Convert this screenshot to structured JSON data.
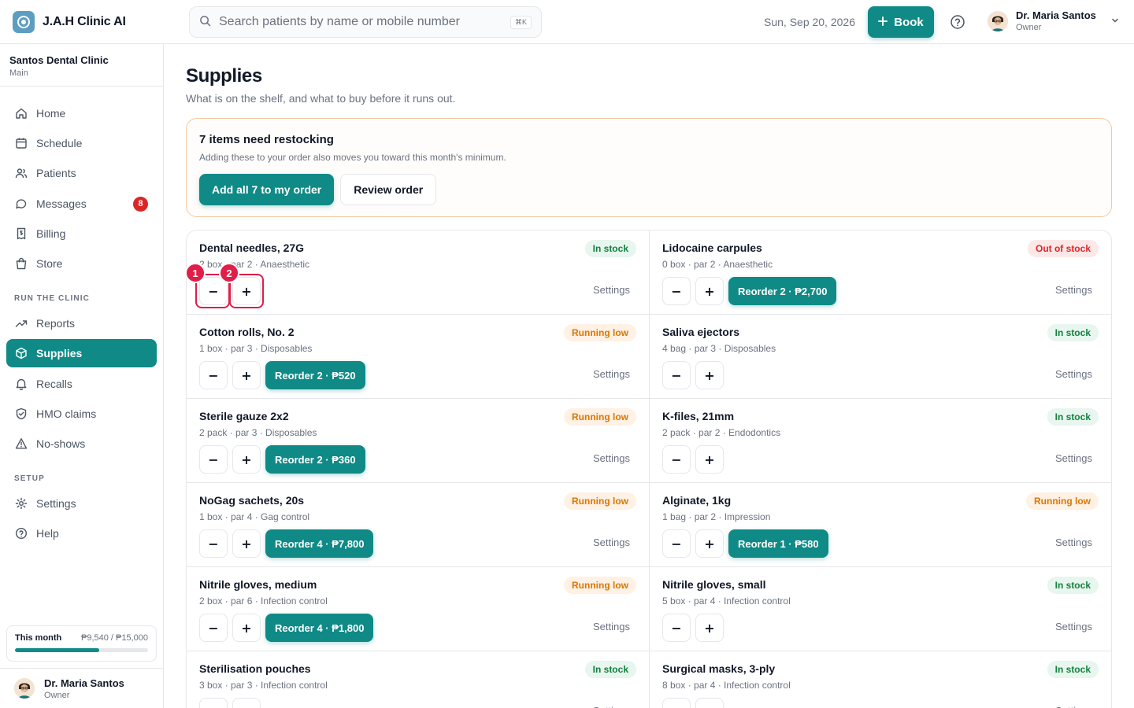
{
  "brand": {
    "name": "J.A.H Clinic AI"
  },
  "search": {
    "placeholder": "Search patients by name or mobile number",
    "shortcut": "⌘K"
  },
  "topbar": {
    "date": "Sun, Sep 20, 2026",
    "book_label": "Book"
  },
  "user": {
    "name": "Dr. Maria Santos",
    "role": "Owner"
  },
  "clinic": {
    "name": "Santos Dental Clinic",
    "branch": "Main"
  },
  "sidebar": {
    "main_items": [
      {
        "label": "Home",
        "icon": "home-icon"
      },
      {
        "label": "Schedule",
        "icon": "calendar-icon"
      },
      {
        "label": "Patients",
        "icon": "users-icon"
      },
      {
        "label": "Messages",
        "icon": "chat-icon",
        "badge": "8"
      },
      {
        "label": "Billing",
        "icon": "receipt-icon"
      },
      {
        "label": "Store",
        "icon": "bag-icon"
      }
    ],
    "run_label": "RUN THE CLINIC",
    "run_items": [
      {
        "label": "Reports",
        "icon": "trend-icon"
      },
      {
        "label": "Supplies",
        "icon": "box-icon",
        "active": true
      },
      {
        "label": "Recalls",
        "icon": "bell-icon"
      },
      {
        "label": "HMO claims",
        "icon": "shield-icon"
      },
      {
        "label": "No-shows",
        "icon": "warning-icon"
      }
    ],
    "setup_label": "SETUP",
    "setup_items": [
      {
        "label": "Settings",
        "icon": "gear-icon"
      },
      {
        "label": "Help",
        "icon": "help-icon"
      }
    ]
  },
  "month": {
    "label": "This month",
    "value": "₱9,540 / ₱15,000",
    "progress": 0.636
  },
  "page": {
    "title": "Supplies",
    "subtitle": "What is on the shelf, and what to buy before it runs out."
  },
  "restock": {
    "title": "7 items need restocking",
    "subtitle": "Adding these to your order also moves you toward this month's minimum.",
    "add_label": "Add all 7 to my order",
    "review_label": "Review order"
  },
  "settings_label": "Settings",
  "minus_label": "−",
  "plus_label": "+",
  "markers": [
    "1",
    "2"
  ],
  "supplies": [
    {
      "name": "Dental needles, 27G",
      "meta": "2 box · par 2 · Anaesthetic",
      "status": "In stock",
      "kind": "in",
      "reorder": ""
    },
    {
      "name": "Lidocaine carpules",
      "meta": "0 box · par 2 · Anaesthetic",
      "status": "Out of stock",
      "kind": "out",
      "reorder": "Reorder 2 · ₱2,700"
    },
    {
      "name": "Cotton rolls, No. 2",
      "meta": "1 box · par 3 · Disposables",
      "status": "Running low",
      "kind": "low",
      "reorder": "Reorder 2 · ₱520"
    },
    {
      "name": "Saliva ejectors",
      "meta": "4 bag · par 3 · Disposables",
      "status": "In stock",
      "kind": "in",
      "reorder": ""
    },
    {
      "name": "Sterile gauze 2x2",
      "meta": "2 pack · par 3 · Disposables",
      "status": "Running low",
      "kind": "low",
      "reorder": "Reorder 2 · ₱360"
    },
    {
      "name": "K-files, 21mm",
      "meta": "2 pack · par 2 · Endodontics",
      "status": "In stock",
      "kind": "in",
      "reorder": ""
    },
    {
      "name": "NoGag sachets, 20s",
      "meta": "1 box · par 4 · Gag control",
      "status": "Running low",
      "kind": "low",
      "reorder": "Reorder 4 · ₱7,800"
    },
    {
      "name": "Alginate, 1kg",
      "meta": "1 bag · par 2 · Impression",
      "status": "Running low",
      "kind": "low",
      "reorder": "Reorder 1 · ₱580"
    },
    {
      "name": "Nitrile gloves, medium",
      "meta": "2 box · par 6 · Infection control",
      "status": "Running low",
      "kind": "low",
      "reorder": "Reorder 4 · ₱1,800"
    },
    {
      "name": "Nitrile gloves, small",
      "meta": "5 box · par 4 · Infection control",
      "status": "In stock",
      "kind": "in",
      "reorder": ""
    },
    {
      "name": "Sterilisation pouches",
      "meta": "3 box · par 3 · Infection control",
      "status": "In stock",
      "kind": "in",
      "reorder": ""
    },
    {
      "name": "Surgical masks, 3-ply",
      "meta": "8 box · par 4 · Infection control",
      "status": "In stock",
      "kind": "in",
      "reorder": ""
    }
  ],
  "colors": {
    "accent": "#0f8a86",
    "danger": "#dc2626",
    "warning": "#d97706",
    "success": "#15803d",
    "marker": "#e11d48"
  }
}
